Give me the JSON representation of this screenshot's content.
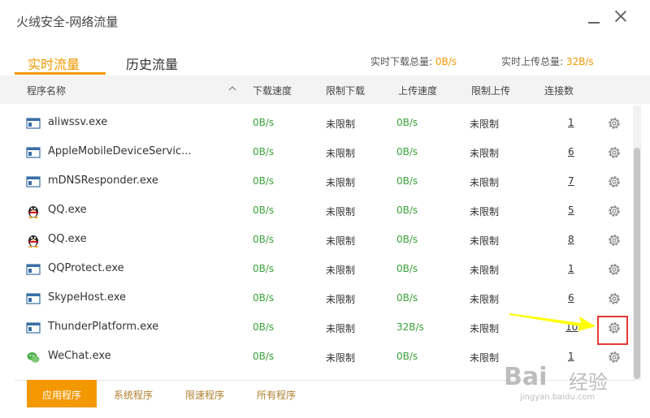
{
  "window": {
    "title": "火绒安全-网络流量"
  },
  "tabs": [
    {
      "label": "实时流量",
      "active": true
    },
    {
      "label": "历史流量",
      "active": false
    }
  ],
  "totals": {
    "down_label": "实时下载总量:",
    "down_value": "0B/s",
    "up_label": "实时上传总量:",
    "up_value": "32B/s"
  },
  "columns": [
    "程序名称",
    "下载速度",
    "限制下载",
    "上传速度",
    "限制上传",
    "连接数"
  ],
  "rows": [
    {
      "name": "aliwssv.exe",
      "icon": "window-icon",
      "down": "0B/s",
      "down_limit": "未限制",
      "up": "0B/s",
      "up_limit": "未限制",
      "connections": "1"
    },
    {
      "name": "AppleMobileDeviceServic...",
      "icon": "window-icon",
      "down": "0B/s",
      "down_limit": "未限制",
      "up": "0B/s",
      "up_limit": "未限制",
      "connections": "6"
    },
    {
      "name": "mDNSResponder.exe",
      "icon": "window-icon",
      "down": "0B/s",
      "down_limit": "未限制",
      "up": "0B/s",
      "up_limit": "未限制",
      "connections": "7"
    },
    {
      "name": "QQ.exe",
      "icon": "qq-penguin-icon",
      "down": "0B/s",
      "down_limit": "未限制",
      "up": "0B/s",
      "up_limit": "未限制",
      "connections": "5"
    },
    {
      "name": "QQ.exe",
      "icon": "qq-penguin-icon",
      "down": "0B/s",
      "down_limit": "未限制",
      "up": "0B/s",
      "up_limit": "未限制",
      "connections": "8"
    },
    {
      "name": "QQProtect.exe",
      "icon": "window-icon",
      "down": "0B/s",
      "down_limit": "未限制",
      "up": "0B/s",
      "up_limit": "未限制",
      "connections": "1"
    },
    {
      "name": "SkypeHost.exe",
      "icon": "window-icon",
      "down": "0B/s",
      "down_limit": "未限制",
      "up": "0B/s",
      "up_limit": "未限制",
      "connections": "6"
    },
    {
      "name": "ThunderPlatform.exe",
      "icon": "window-icon",
      "down": "0B/s",
      "down_limit": "未限制",
      "up": "32B/s",
      "up_limit": "未限制",
      "connections": "10"
    },
    {
      "name": "WeChat.exe",
      "icon": "wechat-icon",
      "down": "0B/s",
      "down_limit": "未限制",
      "up": "0B/s",
      "up_limit": "未限制",
      "connections": "1"
    }
  ],
  "footer_tabs": [
    {
      "label": "应用程序",
      "active": true
    },
    {
      "label": "系统程序",
      "active": false
    },
    {
      "label": "限速程序",
      "active": false
    },
    {
      "label": "所有程序",
      "active": false
    }
  ],
  "watermark": {
    "brand": "Bai",
    "cn": "经验",
    "url": "jingyan.baidu.com"
  },
  "colors": {
    "accent": "#f39800",
    "speed_green": "#3aa33a",
    "highlight_red": "#e53935",
    "annotation_arrow": "#ffff00"
  }
}
